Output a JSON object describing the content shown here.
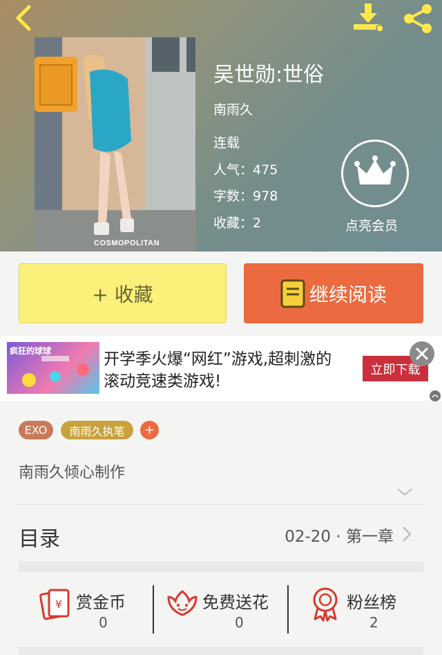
{
  "book": {
    "title": "吴世勋:世俗",
    "author": "南雨久",
    "status": "连载",
    "popularity_label": "人气：",
    "popularity": "475",
    "word_count_label": "字数：",
    "word_count": "978",
    "favorites_label": "收藏：",
    "favorites": "2",
    "cover_logo": "COSMOPOLITAN"
  },
  "header": {
    "back_icon": "chevron-left-icon",
    "download_icon": "download-icon",
    "share_icon": "share-icon"
  },
  "vip": {
    "label": "点亮会员",
    "icon": "crown-icon"
  },
  "actions": {
    "favorite_label": "+ 收藏",
    "read_label": "继续阅读"
  },
  "ad": {
    "text": "开学季火爆“网红”游戏,超刺激的滚动竞速类游戏!",
    "button_label": "立即下载",
    "image_caption": "疯狂的球球"
  },
  "tags": [
    {
      "label": "EXO"
    },
    {
      "label": "南雨久执笔"
    }
  ],
  "add_tag_label": "+",
  "description": "南雨久倾心制作",
  "toc": {
    "title": "目录",
    "latest": "02-20 · 第一章"
  },
  "support": [
    {
      "label": "赏金币",
      "count": "0",
      "icon": "coin-envelope-icon"
    },
    {
      "label": "免费送花",
      "count": "0",
      "icon": "flower-icon"
    },
    {
      "label": "粉丝榜",
      "count": "2",
      "icon": "ribbon-badge-icon"
    }
  ],
  "colors": {
    "accent_orange": "#ec6a3f",
    "favorite_yellow": "#faf07a",
    "tag_exo": "#c97a5a",
    "tag_author": "#c9a23c"
  }
}
